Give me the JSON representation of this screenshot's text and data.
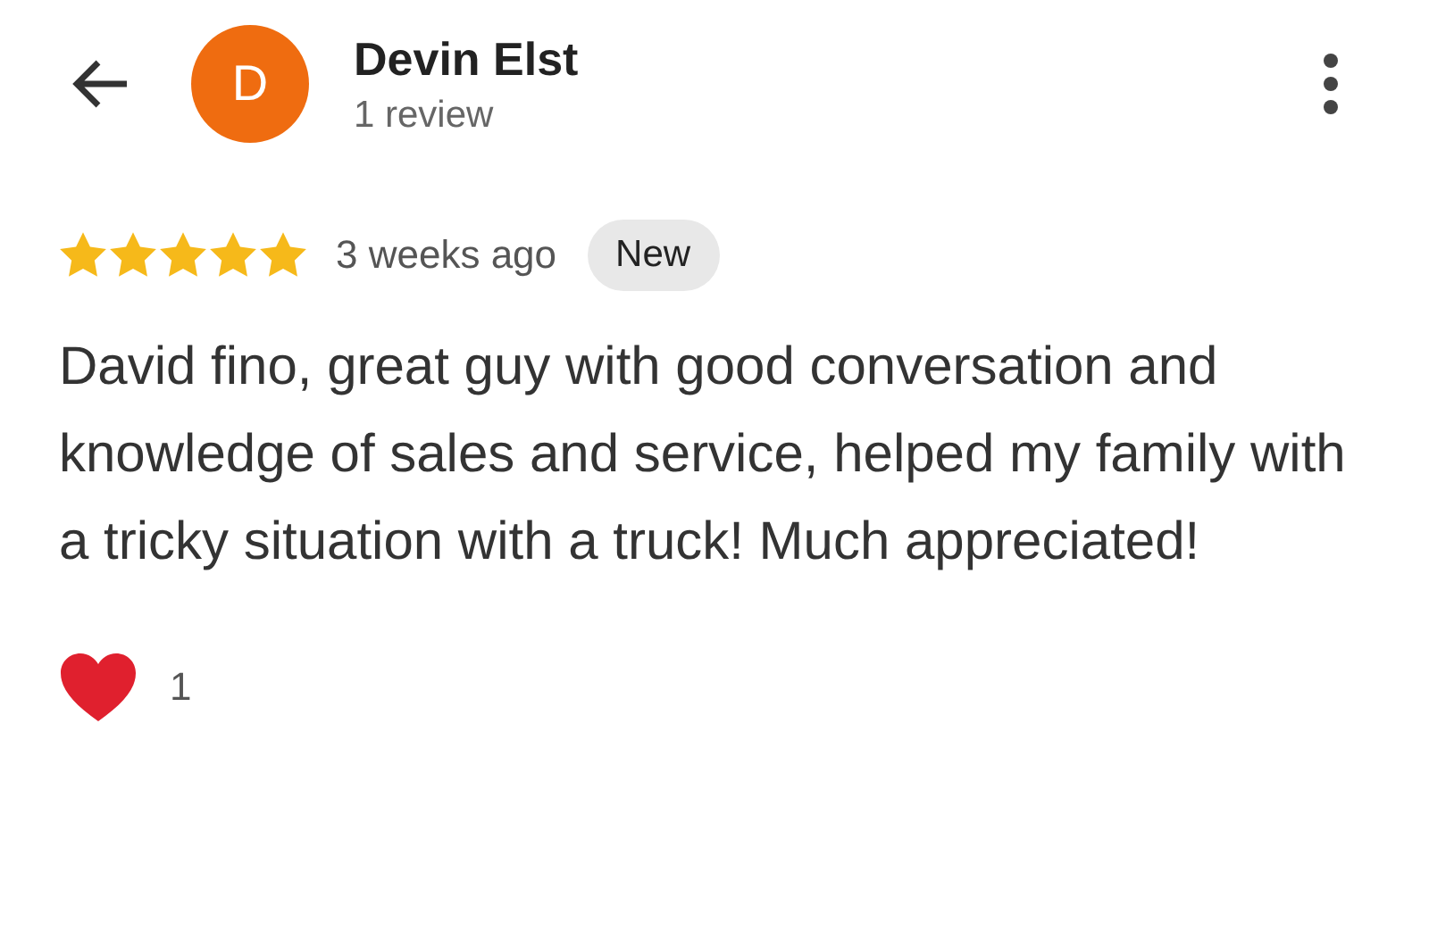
{
  "reviewer": {
    "initial": "D",
    "name": "Devin Elst",
    "count": "1 review"
  },
  "review": {
    "stars": 5,
    "time": "3 weeks ago",
    "badge": "New",
    "text": "David fino, great guy with good conversation and knowledge of sales and service, helped my family with a tricky situation with a truck! Much appreciated!"
  },
  "reactions": {
    "count": "1"
  }
}
